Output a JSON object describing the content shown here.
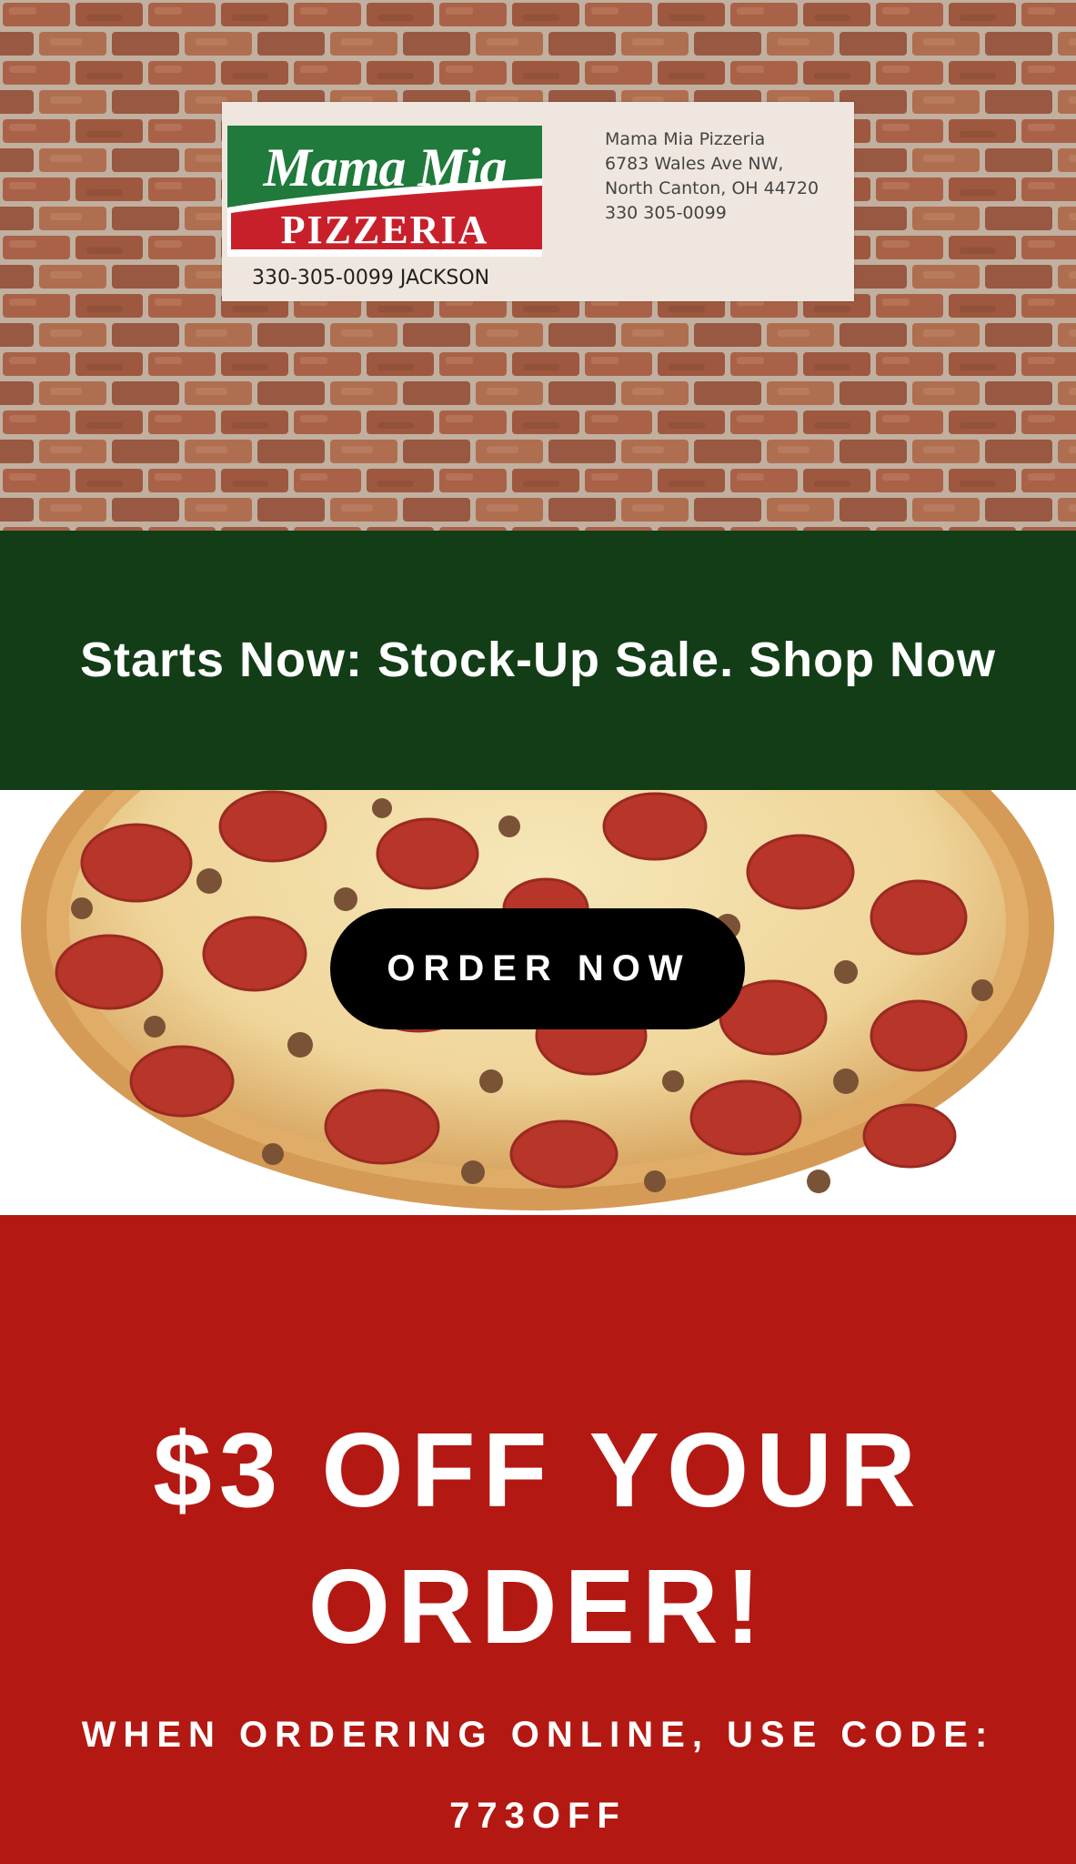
{
  "header": {
    "logo": {
      "brand_line": "Mama Mia",
      "sub_line": "PIZZERIA"
    },
    "card_phone_line": "330-305-0099 JACKSON",
    "card_address": {
      "name": "Mama Mia Pizzeria",
      "street": "6783 Wales Ave NW,",
      "city": "North Canton, OH 44720",
      "phone": "330 305-0099"
    }
  },
  "promo": {
    "text": "Starts Now: Stock-Up Sale. Shop Now"
  },
  "hero": {
    "order_button_label": "ORDER NOW"
  },
  "offer": {
    "headline": "$3 OFF YOUR ORDER!",
    "instructions": "WHEN ORDERING ONLINE, USE CODE:",
    "code": "773OFF"
  },
  "colors": {
    "brick": "#a3674c",
    "promo_green": "#123d16",
    "logo_green": "#1f7a3b",
    "logo_red": "#c8202b",
    "offer_red": "#b41812",
    "button_black": "#000000"
  }
}
